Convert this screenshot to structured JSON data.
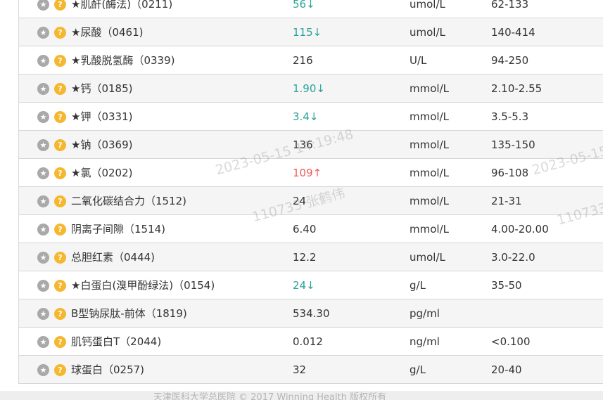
{
  "rows": [
    {
      "star": "★",
      "help": "?",
      "name": "★肌酐(酶法)（0211)",
      "result": "56↓",
      "flag": "low",
      "unit": "umol/L",
      "range": "62-133"
    },
    {
      "star": "★",
      "help": "?",
      "name": "★尿酸（0461)",
      "result": "115↓",
      "flag": "low",
      "unit": "umol/L",
      "range": "140-414"
    },
    {
      "star": "★",
      "help": "?",
      "name": "★乳酸脱氢酶（0339)",
      "result": "216",
      "flag": "normal",
      "unit": "U/L",
      "range": "94-250"
    },
    {
      "star": "★",
      "help": "?",
      "name": "★钙（0185)",
      "result": "1.90↓",
      "flag": "low",
      "unit": "mmol/L",
      "range": "2.10-2.55"
    },
    {
      "star": "★",
      "help": "?",
      "name": "★钾（0331)",
      "result": "3.4↓",
      "flag": "low",
      "unit": "mmol/L",
      "range": "3.5-5.3"
    },
    {
      "star": "★",
      "help": "?",
      "name": "★钠（0369)",
      "result": "136",
      "flag": "normal",
      "unit": "mmol/L",
      "range": "135-150"
    },
    {
      "star": "★",
      "help": "?",
      "name": "★氯（0202)",
      "result": "109↑",
      "flag": "high",
      "unit": "mmol/L",
      "range": "96-108"
    },
    {
      "star": "★",
      "help": "?",
      "name": "二氧化碳结合力（1512)",
      "result": "24",
      "flag": "normal",
      "unit": "mmol/L",
      "range": "21-31"
    },
    {
      "star": "★",
      "help": "?",
      "name": "阴离子间隙（1514)",
      "result": "6.40",
      "flag": "normal",
      "unit": "mmol/L",
      "range": "4.00-20.00"
    },
    {
      "star": "★",
      "help": "?",
      "name": "总胆红素（0444)",
      "result": "12.2",
      "flag": "normal",
      "unit": "umol/L",
      "range": "3.0-22.0"
    },
    {
      "star": "★",
      "help": "?",
      "name": "★白蛋白(溴甲酚绿法)（0154)",
      "result": "24↓",
      "flag": "low",
      "unit": "g/L",
      "range": "35-50"
    },
    {
      "star": "★",
      "help": "?",
      "name": "B型钠尿肽-前体（1819)",
      "result": "534.30",
      "flag": "normal",
      "unit": "pg/ml",
      "range": ""
    },
    {
      "star": "★",
      "help": "?",
      "name": "肌钙蛋白T（2044)",
      "result": "0.012",
      "flag": "normal",
      "unit": "ng/ml",
      "range": "<0.100"
    },
    {
      "star": "★",
      "help": "?",
      "name": "球蛋白（0257)",
      "result": "32",
      "flag": "normal",
      "unit": "g/L",
      "range": "20-40"
    }
  ],
  "watermark": {
    "line1": "2023-05-15 14:19:48",
    "line2": "110733 张鹤伟",
    "line1_right": "2023-05-15 1",
    "line2_right": "110733 张"
  },
  "footer": {
    "text": "天津医科大学总医院      © 2017 Winning Health 版权所有"
  },
  "colors": {
    "low": "#2aa198",
    "high": "#f05a5a",
    "help_badge": "#f5b72e",
    "star_badge": "#a9a9a9"
  }
}
